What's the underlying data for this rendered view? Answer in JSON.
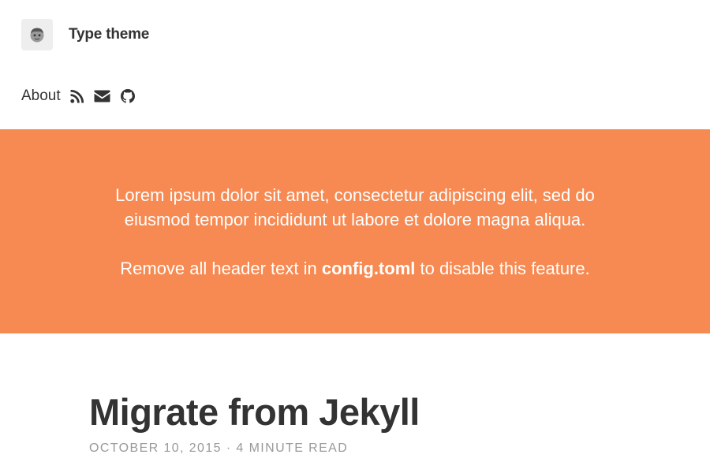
{
  "header": {
    "site_title": "Type theme",
    "avatar_icon": "avatar-icon",
    "nav": {
      "about_label": "About",
      "icons": [
        "rss-icon",
        "envelope-icon",
        "github-icon"
      ]
    }
  },
  "intro": {
    "background_color": "#f78a52",
    "paragraph1": "Lorem ipsum dolor sit amet, consectetur adipiscing elit, sed do eiusmod tempor incididunt ut labore et dolore magna aliqua.",
    "paragraph2_before": "Remove all header text in ",
    "paragraph2_bold": "config.toml",
    "paragraph2_after": " to disable this feature."
  },
  "post": {
    "title": "Migrate from Jekyll",
    "date": "October 10, 2015",
    "separator": "·",
    "read_time": "4 minute read"
  }
}
